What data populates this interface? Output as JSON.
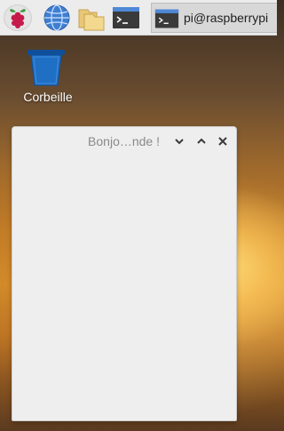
{
  "taskbar": {
    "items": [
      {
        "icon": "raspberry-menu-icon"
      },
      {
        "icon": "web-browser-globe-icon"
      },
      {
        "icon": "file-manager-folder-icon"
      },
      {
        "icon": "terminal-icon"
      }
    ],
    "active_window": {
      "icon": "terminal-icon",
      "label": "pi@raspberrypi"
    }
  },
  "desktop": {
    "icons": [
      {
        "icon": "trash-bin-icon",
        "label": "Corbeille"
      }
    ]
  },
  "window": {
    "title": "Bonjo…nde !",
    "controls": {
      "minimize_icon": "chevron-down-icon",
      "maximize_icon": "chevron-up-icon",
      "close_icon": "close-icon"
    }
  },
  "colors": {
    "taskbar_bg": "#ececec",
    "window_bg": "#eeeeee",
    "title_text": "#8a8a8a",
    "trash_blue": "#1f6fc4"
  }
}
